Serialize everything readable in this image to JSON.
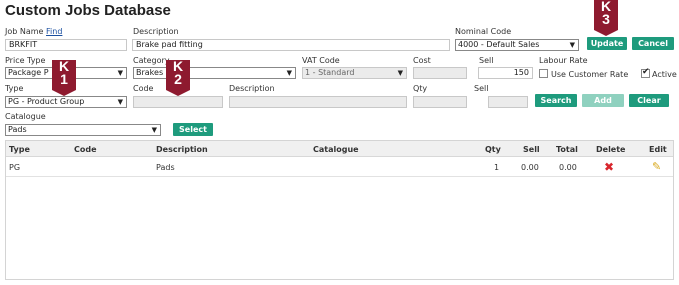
{
  "page_title": "Custom Jobs Database",
  "job_name": {
    "label": "Job Name",
    "find_link": "Find",
    "value": "BRKFIT"
  },
  "description": {
    "label": "Description",
    "value": "Brake pad fitting"
  },
  "nominal_code": {
    "label": "Nominal Code",
    "value": "4000 - Default Sales"
  },
  "update_button": "Update",
  "cancel_button": "Cancel",
  "price_type": {
    "label": "Price Type",
    "value": "Package P"
  },
  "category": {
    "label": "Category",
    "value": "Brakes"
  },
  "vat_code": {
    "label": "VAT Code",
    "value": "1 - Standard"
  },
  "cost": {
    "label": "Cost",
    "value": ""
  },
  "sell": {
    "label": "Sell",
    "value": "150"
  },
  "labour_rate": {
    "label": "Labour Rate",
    "use_customer_rate": "Use Customer Rate",
    "active": "Active"
  },
  "line": {
    "type_label": "Type",
    "type_value": "PG - Product Group",
    "code_label": "Code",
    "description_label": "Description",
    "qty_label": "Qty",
    "sell_label": "Sell",
    "search_button": "Search",
    "add_button": "Add",
    "clear_button": "Clear"
  },
  "catalogue": {
    "label": "Catalogue",
    "value": "Pads",
    "select_button": "Select"
  },
  "table": {
    "headers": {
      "type": "Type",
      "code": "Code",
      "description": "Description",
      "catalogue": "Catalogue",
      "qty": "Qty",
      "sell": "Sell",
      "total": "Total",
      "delete": "Delete",
      "edit": "Edit"
    },
    "rows": [
      {
        "type": "PG",
        "code": "",
        "description": "Pads",
        "catalogue": "",
        "qty": "1",
        "sell": "0.00",
        "total": "0.00"
      }
    ]
  },
  "badges": {
    "k1": [
      "K",
      "1"
    ],
    "k2": [
      "K",
      "2"
    ],
    "k3": [
      "K",
      "3"
    ]
  },
  "colors": {
    "button": "#1e9b7d",
    "button_disabled": "#8fd1bf",
    "badge": "#8e1a2f",
    "delete": "#d8262d",
    "edit": "#d8a81c"
  },
  "icons": {
    "dropdown": "chevron-down-icon",
    "delete": "delete-x-icon",
    "edit": "pencil-icon"
  }
}
